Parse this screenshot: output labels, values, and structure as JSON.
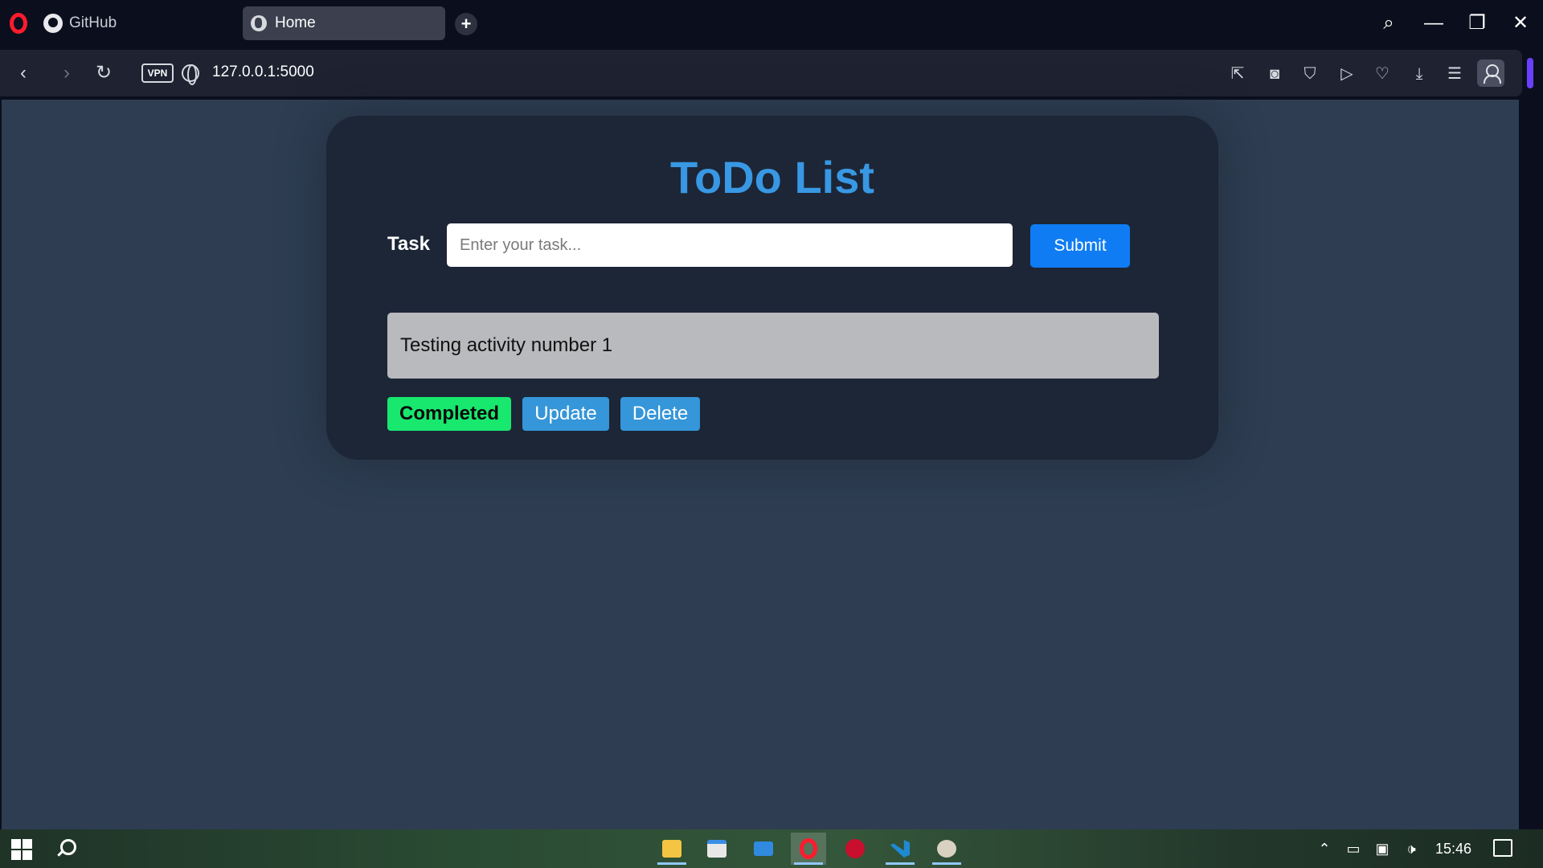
{
  "browser": {
    "tabs": [
      {
        "label": "GitHub",
        "icon": "github-icon"
      },
      {
        "label": "Home",
        "icon": "globe-icon",
        "active": true
      }
    ],
    "new_tab_symbol": "+",
    "window_controls": {
      "search": "⌕",
      "minimize": "—",
      "restore": "❐",
      "close": "✕"
    },
    "address": {
      "back": "‹",
      "forward": "›",
      "reload": "↻",
      "vpn_label": "VPN",
      "url": "127.0.0.1:5000"
    },
    "toolbar_icons": [
      "snap-icon",
      "camera-icon",
      "shield-icon",
      "play-icon",
      "heart-icon",
      "download-icon",
      "menu-icon",
      "profile-icon"
    ]
  },
  "app": {
    "title": "ToDo List",
    "task_label": "Task",
    "input_placeholder": "Enter your task...",
    "submit_label": "Submit",
    "tasks": [
      {
        "text": "Testing activity number 1",
        "actions": {
          "completed": "Completed",
          "update": "Update",
          "delete": "Delete"
        }
      }
    ],
    "colors": {
      "title": "#3898e3",
      "submit": "#0f7cf3",
      "completed": "#18e86e",
      "action": "#3596d9"
    }
  },
  "taskbar": {
    "apps": [
      "file-explorer-icon",
      "store-icon",
      "mail-icon",
      "opera-icon",
      "davinci-icon",
      "vscode-icon",
      "paint-icon"
    ],
    "clock": "15:46"
  }
}
